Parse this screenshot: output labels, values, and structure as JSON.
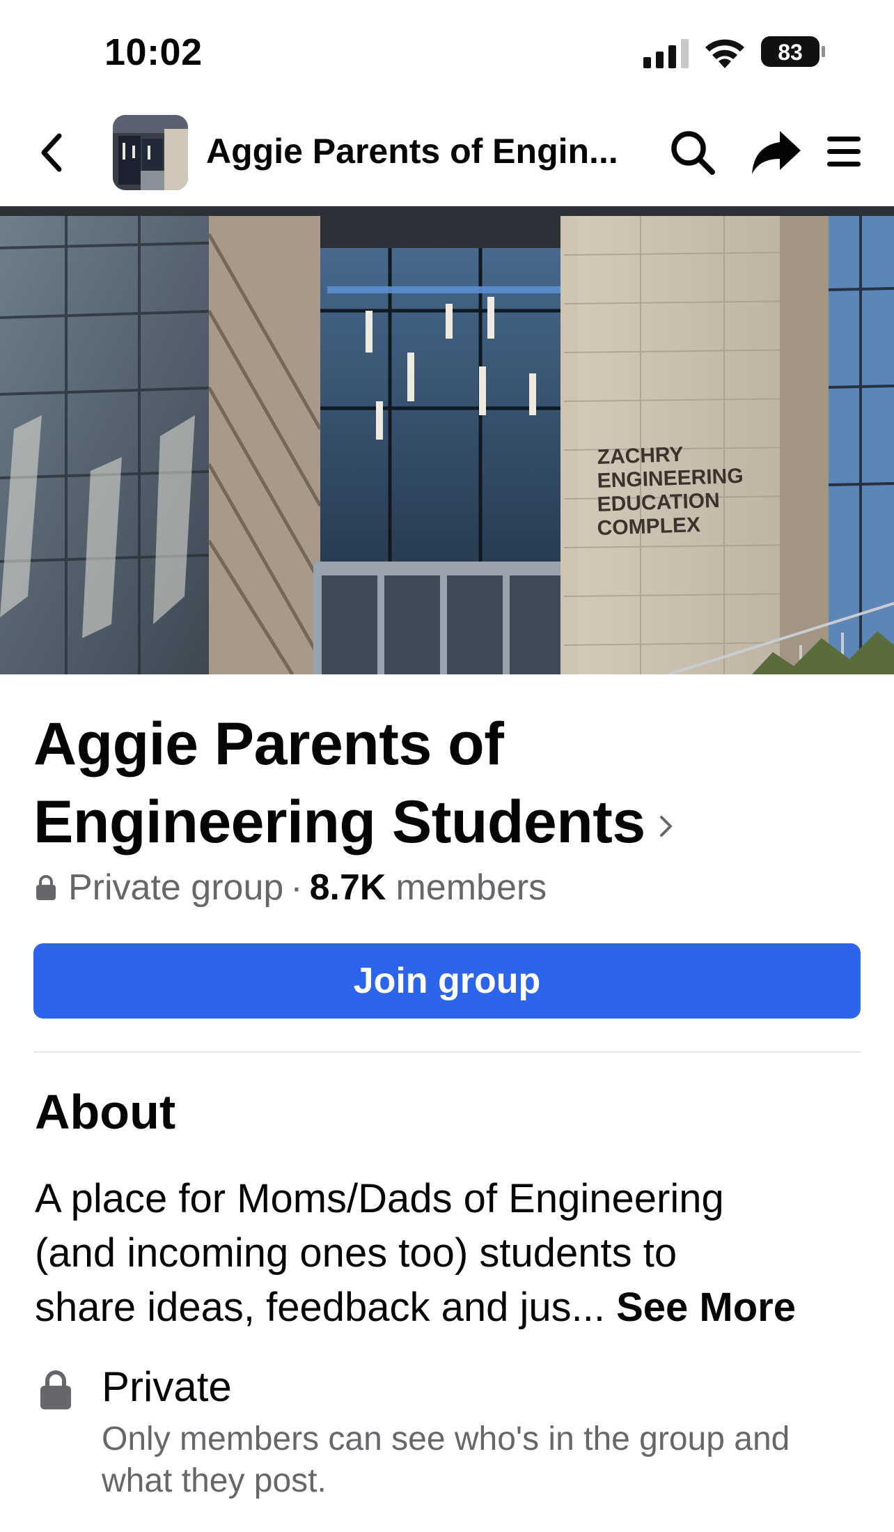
{
  "status_bar": {
    "time": "10:02",
    "battery_level": "83",
    "icons": [
      "signal-icon",
      "wifi-icon",
      "battery-icon"
    ]
  },
  "nav": {
    "title": "Aggie Parents of Engin...",
    "icons": [
      "back-chevron-icon",
      "search-icon",
      "share-icon",
      "menu-icon"
    ]
  },
  "cover": {
    "sign_lines": [
      "ZACHRY",
      "ENGINEERING",
      "EDUCATION",
      "COMPLEX"
    ]
  },
  "group": {
    "name_line1": "Aggie Parents of",
    "name_line2": "Engineering Students",
    "privacy": "Private group",
    "separator": "·",
    "member_count": "8.7K",
    "members_label": "members",
    "join_label": "Join group"
  },
  "about": {
    "heading": "About",
    "line1": "A place for Moms/Dads of Engineering",
    "line2": "(and incoming ones too) students to",
    "line3": "share ideas, feedback and jus...",
    "see_more": "See More"
  },
  "privacy_info": {
    "title": "Private",
    "desc_line1": "Only members can see who's in the group and",
    "desc_line2": "what they post."
  },
  "colors": {
    "primary_blue": "#2d64ec",
    "secondary_text": "#65676b",
    "divider": "#e4e6eb"
  }
}
